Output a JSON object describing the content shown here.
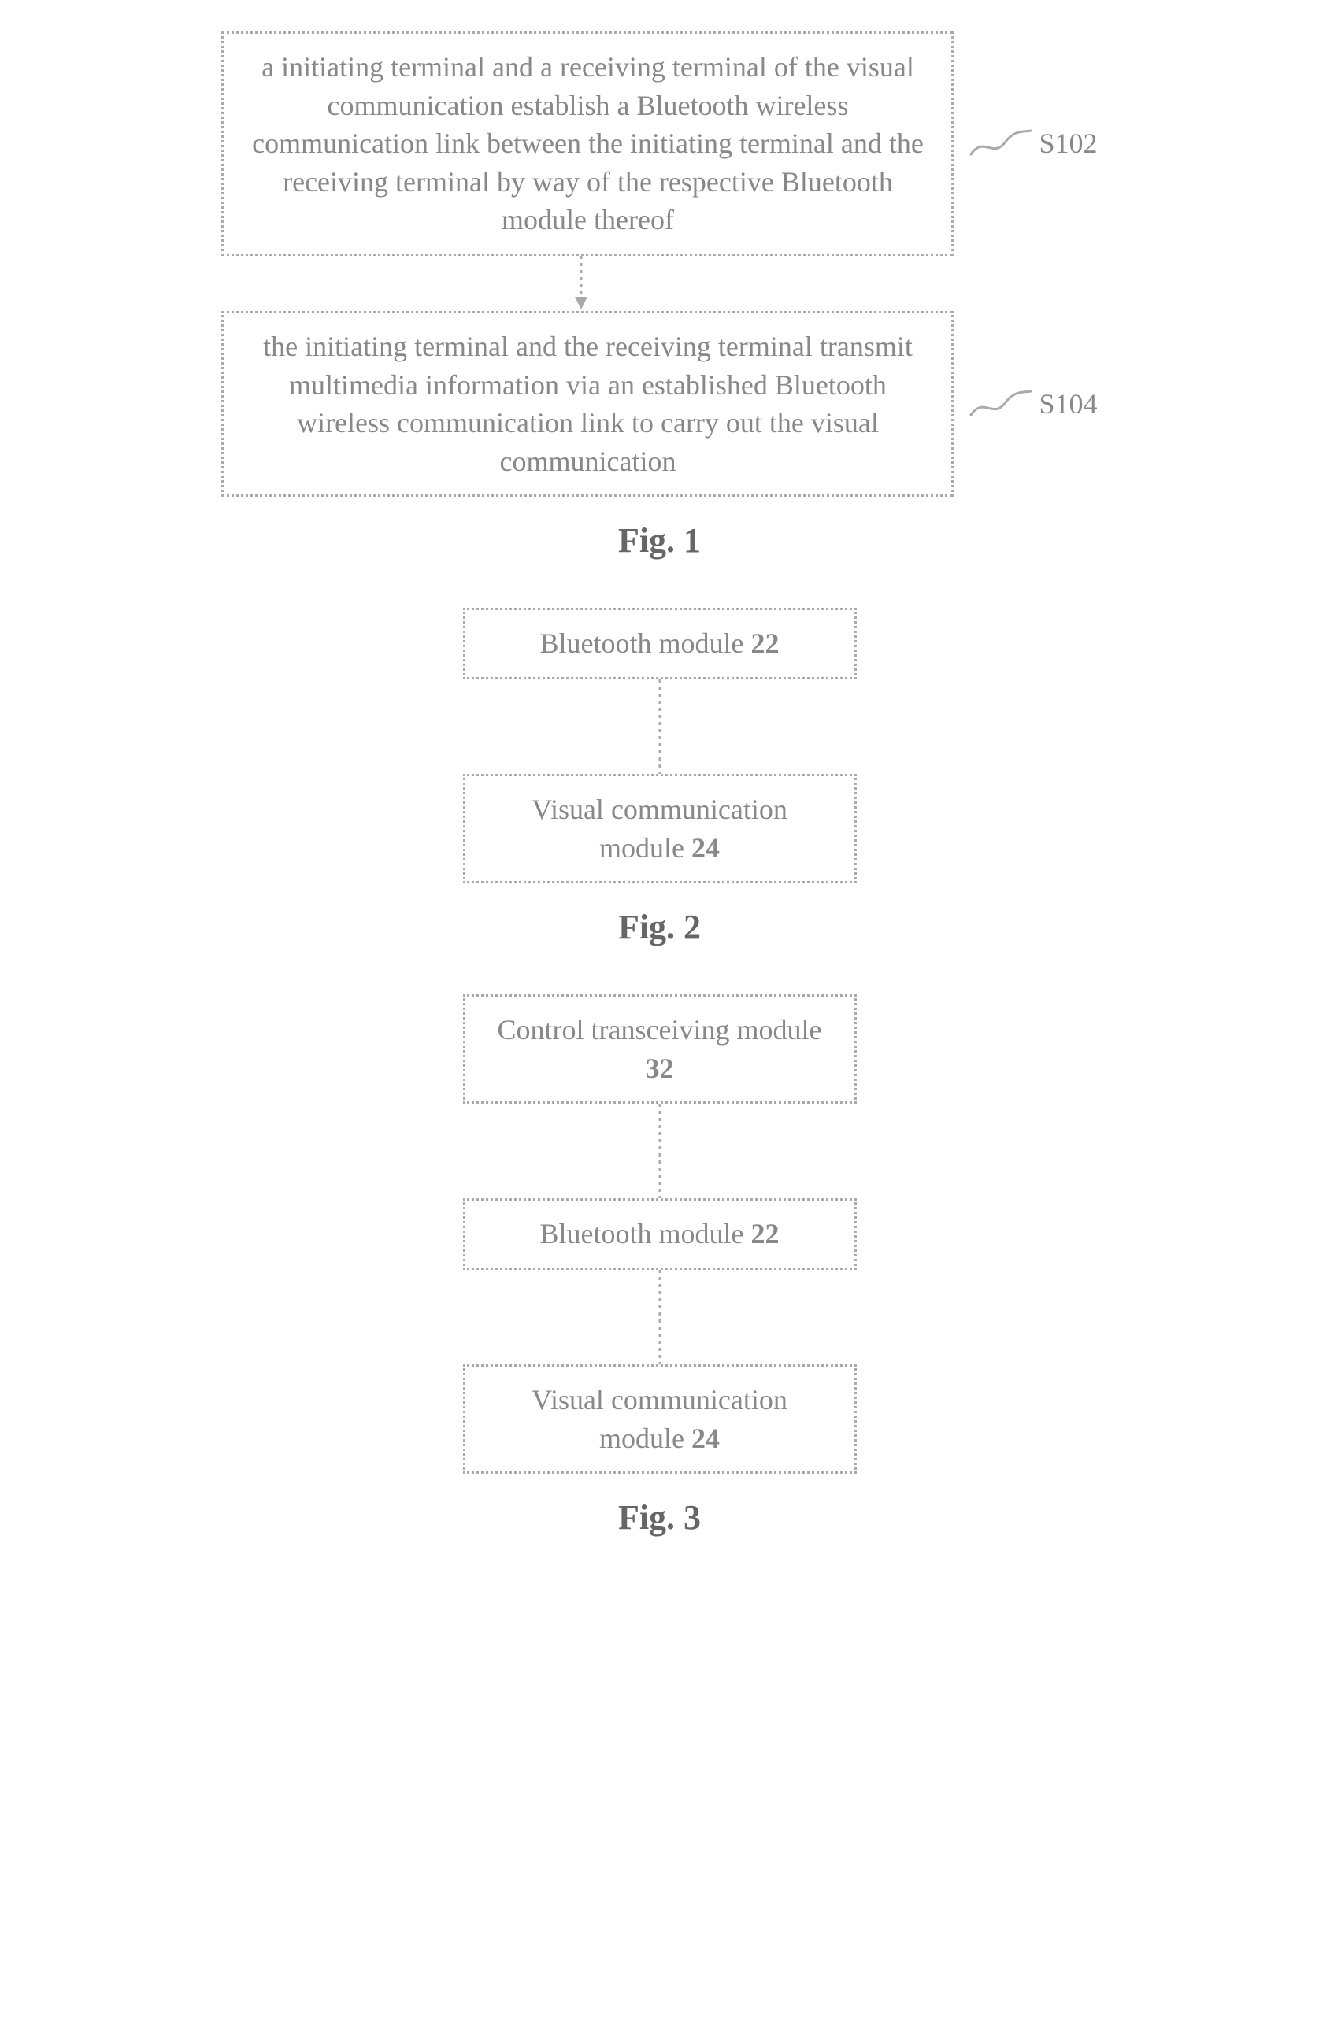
{
  "fig1": {
    "box1": "a initiating terminal and a receiving terminal of the visual communication establish a Bluetooth wireless communication link between the initiating terminal and the receiving terminal by way of the respective Bluetooth module thereof",
    "label1": "S102",
    "box2": "the initiating terminal and the receiving terminal transmit multimedia information via an established Bluetooth wireless communication link to carry out the visual communication",
    "label2": "S104",
    "caption": "Fig. 1"
  },
  "fig2": {
    "box1_text": "Bluetooth module ",
    "box1_num": "22",
    "box2_text": "Visual communication module ",
    "box2_num": "24",
    "caption": "Fig. 2"
  },
  "fig3": {
    "box1_text": "Control transceiving module ",
    "box1_num": "32",
    "box2_text": "Bluetooth module ",
    "box2_num": "22",
    "box3_text": "Visual communication module ",
    "box3_num": "24",
    "caption": "Fig. 3"
  }
}
